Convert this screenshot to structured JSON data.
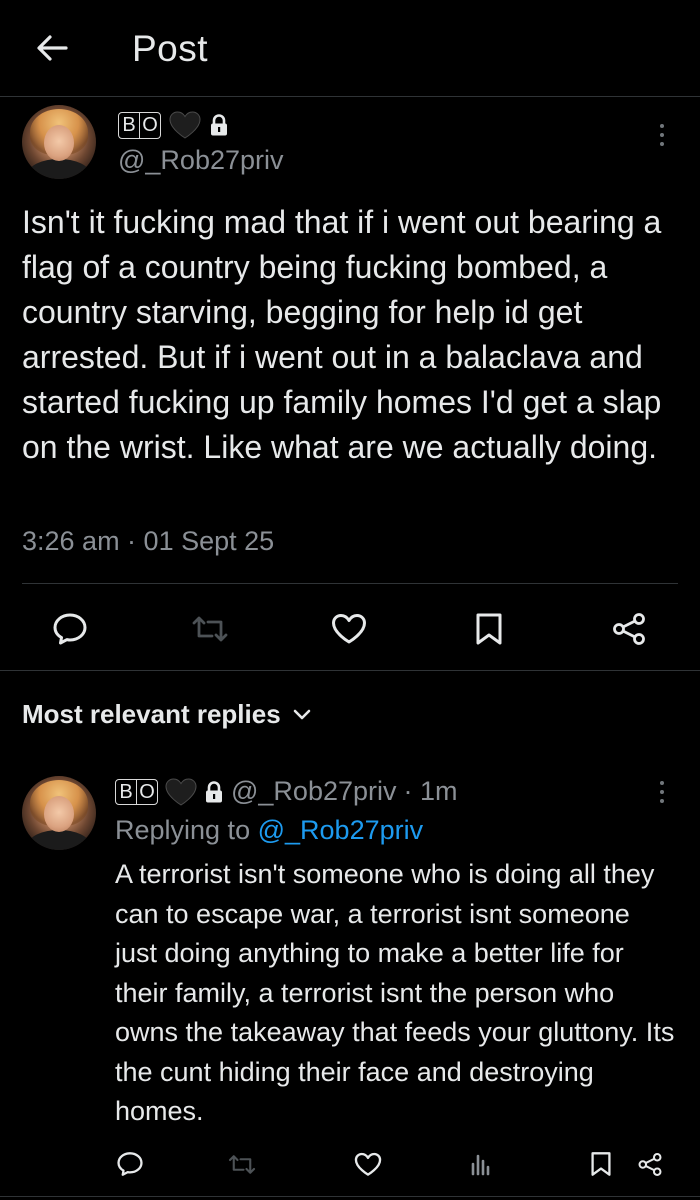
{
  "header": {
    "title": "Post"
  },
  "post": {
    "display_name_badge": [
      "B",
      "O"
    ],
    "handle": "@_Rob27priv",
    "text": "Isn't it fucking mad that if i went out bearing a flag of a country being fucking bombed, a country starving, begging for help id get arrested. But if i went out in a balaclava and started fucking up family homes I'd get a slap on the wrist. Like what are we actually doing.",
    "timestamp": "3:26 am · 01 Sept 25"
  },
  "replies_section": {
    "label": "Most relevant replies"
  },
  "reply": {
    "display_name_badge": [
      "B",
      "O"
    ],
    "handle": "@_Rob27priv",
    "time": "· 1m",
    "replying_prefix": "Replying to",
    "replying_handle": "@_Rob27priv",
    "text": "A terrorist isn't someone who is doing all they can to escape war, a terrorist isnt someone just doing anything to make a better life for their family, a terrorist isnt the person who owns the takeaway that feeds your gluttony. Its the cunt hiding their face and destroying homes."
  },
  "icons": {
    "back": "arrow-left-icon",
    "heart_badge": "black-heart-icon",
    "lock": "lock-icon",
    "more": "more-vertical-icon",
    "reply": "reply-icon",
    "repost": "repost-icon",
    "like": "like-icon",
    "bookmark": "bookmark-icon",
    "share": "share-icon",
    "views": "views-icon",
    "chevron": "chevron-down-icon"
  },
  "colors": {
    "background": "#000000",
    "text": "#e7e9ea",
    "secondary_text": "#8b9096",
    "link": "#1d9bf0",
    "divider": "#2f3336"
  }
}
